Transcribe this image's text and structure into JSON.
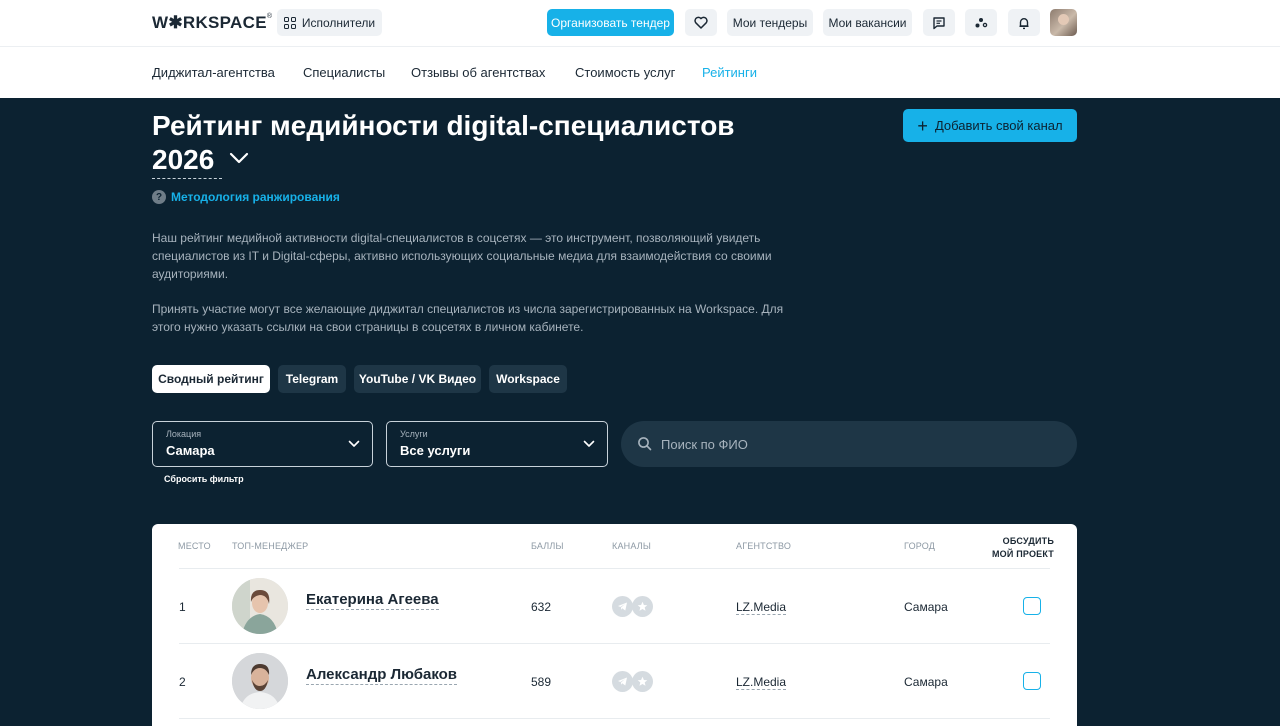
{
  "header": {
    "logo": "W✱RKSPACE",
    "logo_mark": "®",
    "performers_label": "Исполнители",
    "tender_button": "Организовать тендер",
    "my_tenders": "Мои тендеры",
    "my_vacancies": "Мои вакансии"
  },
  "nav": {
    "items": [
      {
        "label": "Диджитал-агентства"
      },
      {
        "label": "Специалисты"
      },
      {
        "label": "Отзывы об агентствах"
      },
      {
        "label": "Стоимость услуг"
      },
      {
        "label": "Рейтинги"
      }
    ]
  },
  "hero": {
    "title": "Рейтинг медийности digital-специалистов",
    "year": "2026",
    "methodology": "Методология ранжирования",
    "add_channel": "Добавить свой канал",
    "description_1": "Наш рейтинг медийной активности digital-специалистов в соцсетях — это инструмент, позволяющий увидеть специалистов из IT и Digital-сферы, активно использующих социальные медиа для взаимодействия со своими аудиториями.",
    "description_2": "Принять участие могут все желающие диджитал специалистов из числа зарегистрированных на Workspace. Для этого нужно указать ссылки на свои страницы в соцсетях в личном кабинете."
  },
  "tabs": [
    "Сводный рейтинг",
    "Telegram",
    "YouTube / VK Видео",
    "Workspace"
  ],
  "filters": {
    "location_label": "Локация",
    "location_value": "Самара",
    "services_label": "Услуги",
    "services_value": "Все услуги",
    "search_placeholder": "Поиск по ФИО",
    "reset": "Сбросить фильтр"
  },
  "table": {
    "headers": {
      "place": "МЕСТО",
      "manager": "ТОП-МЕНЕДЖЕР",
      "score": "БАЛЛЫ",
      "channels": "КАНАЛЫ",
      "agency": "АГЕНТСТВО",
      "city": "ГОРОД",
      "discuss_1": "ОБСУДИТЬ",
      "discuss_2": "МОЙ ПРОЕКТ"
    },
    "rows": [
      {
        "place": "1",
        "name": "Екатерина Агеева",
        "score": "632",
        "agency": "LZ.Media",
        "city": "Самара"
      },
      {
        "place": "2",
        "name": "Александр Любаков",
        "score": "589",
        "agency": "LZ.Media",
        "city": "Самара"
      }
    ]
  }
}
